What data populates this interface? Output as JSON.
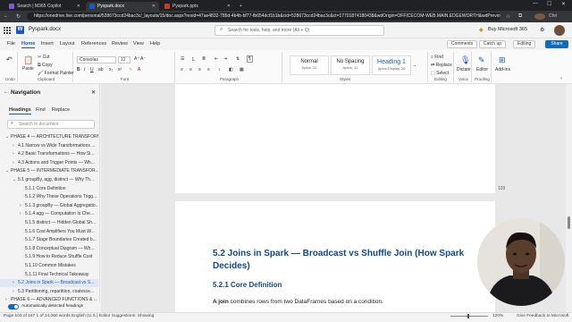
{
  "browser": {
    "tabs": [
      {
        "label": "Search | M365 Copilot",
        "icon_color": "#7b5cd6",
        "active": false
      },
      {
        "label": "Pyspark.docx",
        "icon_color": "#185abd",
        "active": true
      },
      {
        "label": "Pyspark.pptx",
        "icon_color": "#c43e1c",
        "active": false
      }
    ],
    "url": "https://onedrive.live.com/personal/528673ccd24bac3c/_layouts/15/doc.aspx?resid=47ae4832-785d-4b4b-bf77-fb654dcf1b1b&cid=528673ccd24bac3c&ct=17701874180438&wdOrigin=OFFICECOM-WEB.MAIN.EDGEWORTH&wdPreviousSessi...",
    "profile_label": "Chri"
  },
  "word": {
    "app_icon": "W",
    "doc_title": "Pyspark.docx",
    "search_placeholder": "Search for tools, help, and more (Alt + Q)",
    "buy_label": "Buy Microsoft 365",
    "menu": [
      "File",
      "Home",
      "Insert",
      "Layout",
      "References",
      "Review",
      "View",
      "Help"
    ],
    "active_menu": "Home",
    "comments_label": "Comments",
    "catchup_label": "Catch up",
    "editing_label": "Editing",
    "share_label": "Share"
  },
  "ribbon": {
    "undo_label": "Undo",
    "paste_label": "Paste",
    "cut_label": "Cut",
    "copy_label": "Copy",
    "format_painter_label": "Format Painter",
    "clipboard_label": "Clipboard",
    "font_name": "Consolas",
    "font_size": "12",
    "font_label": "Font",
    "paragraph_label": "Paragraph",
    "styles": [
      {
        "name": "Normal",
        "sub": "Aptos, 12"
      },
      {
        "name": "No Spacing",
        "sub": "Aptos, 12"
      },
      {
        "name": "Heading 1",
        "sub": "Aptos Display, 20"
      }
    ],
    "styles_label": "Styles",
    "find_label": "Find",
    "replace_label": "Replace",
    "select_label": "Select",
    "editing_group_label": "Editing",
    "dictate_label": "Dictate",
    "voice_label": "Voice",
    "editor_label": "Editor",
    "proofing_label": "Proofing",
    "addins_label": "Add-ins"
  },
  "navigation": {
    "title": "Navigation",
    "tabs": [
      "Headings",
      "Find",
      "Replace"
    ],
    "active_tab": "Headings",
    "search_placeholder": "Search in document",
    "headings": [
      {
        "text": "PHASE 4 — ARCHITECTURE TRANSFORMATIONS",
        "level": 0,
        "chevron": "v"
      },
      {
        "text": "4.1 Narrow vs Wide Transformations ...",
        "level": 1,
        "chevron": ">"
      },
      {
        "text": "4.2 Basic Transformations — How Si...",
        "level": 1,
        "chevron": ">"
      },
      {
        "text": "4.3 Actions and Trigger Points — Wh...",
        "level": 1,
        "chevron": ">"
      },
      {
        "text": "PHASE 5 — INTERMEDIATE TRANSFOR...",
        "level": 0,
        "chevron": "v"
      },
      {
        "text": "5.1 groupBy, agg, distinct — Why Th...",
        "level": 1,
        "chevron": "v"
      },
      {
        "text": "5.1.1 Core Definition",
        "level": 2,
        "chevron": ""
      },
      {
        "text": "5.1.2 Why These Operations Trigg...",
        "level": 2,
        "chevron": ""
      },
      {
        "text": "5.1.3 groupBy — Global Aggregatio...",
        "level": 2,
        "chevron": ">"
      },
      {
        "text": "5.1.4 agg — Computation Is Che...",
        "level": 2,
        "chevron": ">"
      },
      {
        "text": "5.1.5 distinct — Hidden Global Sh...",
        "level": 2,
        "chevron": ""
      },
      {
        "text": "5.1.6 Cost Amplifiers You Must W...",
        "level": 2,
        "chevron": ""
      },
      {
        "text": "5.1.7 Stage Boundaries Created b...",
        "level": 2,
        "chevron": ""
      },
      {
        "text": "5.1.8 Conceptual Diagram — Wh...",
        "level": 2,
        "chevron": ""
      },
      {
        "text": "5.1.9 How to Reduce Shuffle Cost",
        "level": 2,
        "chevron": ""
      },
      {
        "text": "5.1.10 Common Mistakes",
        "level": 2,
        "chevron": ""
      },
      {
        "text": "5.1.11 Final Technical Takeaway",
        "level": 2,
        "chevron": ""
      },
      {
        "text": "5.2 Joins in Spark — Broadcast vs S...",
        "level": 1,
        "chevron": ">",
        "selected": true
      },
      {
        "text": "5.3 Partitioning, repartition, coalesce...",
        "level": 1,
        "chevron": ">"
      },
      {
        "text": "PHASE 6 — ADVANCED FUNCTIONS & ...",
        "level": 0,
        "chevron": ">"
      }
    ],
    "auto_headings_label": "Automatically detected headings"
  },
  "document": {
    "page_number": "103",
    "heading2": "5.2 Joins in Spark — Broadcast vs Shuffle Join (How Spark Decides)",
    "heading3": "5.2.1 Core Definition",
    "para_lead": "A join",
    "para_rest": " combines rows from two DataFrames based on a condition."
  },
  "status": {
    "text": "Page 103 of 167   1 of 14,060 words   English (U.S.)   Editor Suggestions: Showing",
    "zoom": "120%",
    "feedback": "Give Feedback to Microsoft"
  },
  "colors": {
    "accent": "#185abd",
    "heading": "#0f4a8a",
    "share": "#0f6cbd"
  }
}
